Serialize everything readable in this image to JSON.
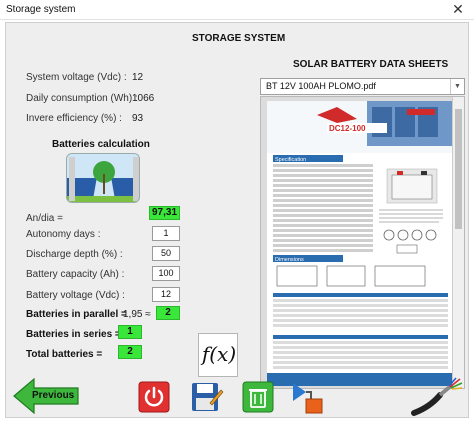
{
  "window": {
    "title": "Storage system",
    "close_glyph": "✕"
  },
  "heading": "STORAGE SYSTEM",
  "params": [
    {
      "label": "System voltage (Vdc) :",
      "value": "12"
    },
    {
      "label": "Daily consumption (Wh) :",
      "value": "1066"
    },
    {
      "label": "Invere efficiency (%) :",
      "value": "93"
    }
  ],
  "batteries_calc_label": "Batteries calculation",
  "calc": {
    "andia": {
      "label": "An/dia =",
      "value": "97,31"
    },
    "autonomy": {
      "label": "Autonomy days :",
      "value": "1"
    },
    "discharge": {
      "label": "Discharge depth (%) :",
      "value": "50"
    },
    "capacity": {
      "label": "Battery capacity (Ah) :",
      "value": "100"
    },
    "voltage": {
      "label": "Battery voltage (Vdc) :",
      "value": "12"
    },
    "parallel": {
      "label": "Batteries in parallel =",
      "approx": "1,95 ≈",
      "value": "2"
    },
    "series": {
      "label": "Batteries in series =",
      "value": "1"
    },
    "total": {
      "label": "Total batteries =",
      "value": "2"
    }
  },
  "datasheets": {
    "label": "SOLAR BATTERY DATA SHEETS",
    "selected": "BT 12V 100AH PLOMO.pdf",
    "doc_model": "DC12-100",
    "doc_section_spec": "Specification",
    "doc_section_dim": "Dimensions"
  },
  "fx_label": "f(x)",
  "buttons": {
    "previous": "Previous"
  },
  "colors": {
    "green": "#39e639",
    "accent_red": "#e03030"
  }
}
